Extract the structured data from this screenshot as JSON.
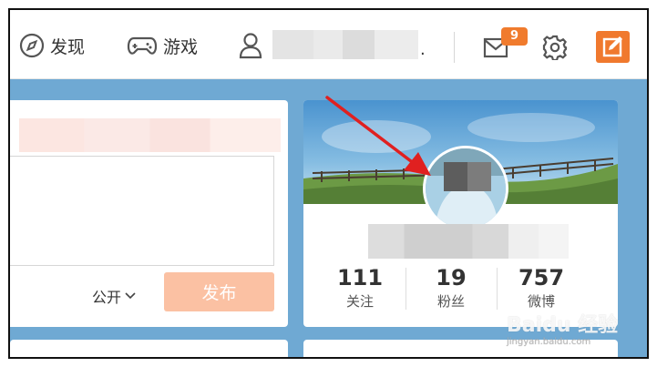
{
  "nav": {
    "discover_label": "发现",
    "games_label": "游戏",
    "separator_dot": ".",
    "message_count": "9"
  },
  "composer": {
    "visibility_label": "公开",
    "publish_label": "发布"
  },
  "profile": {
    "stats": [
      {
        "value": "111",
        "label": "关注"
      },
      {
        "value": "19",
        "label": "粉丝"
      },
      {
        "value": "757",
        "label": "微博"
      }
    ]
  },
  "watermark": {
    "brand": "Baidu 经验",
    "url": "jingyan.baidu.com"
  },
  "colors": {
    "accent": "#f0792e",
    "publish_disabled": "#fbc1a3",
    "background": "#6fa9d3",
    "annotation_arrow": "#e02020"
  }
}
